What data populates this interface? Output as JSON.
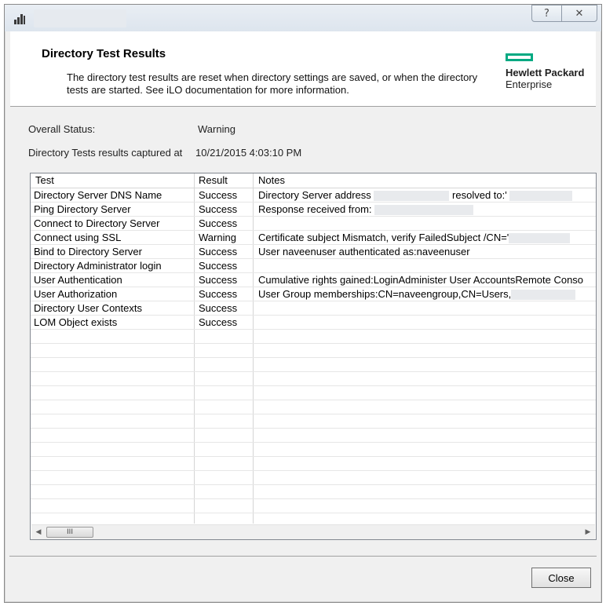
{
  "window": {
    "icons": {
      "app": "app-icon",
      "help": "help-icon",
      "close": "close-icon"
    },
    "help_glyph": "?",
    "close_glyph": "✕"
  },
  "header": {
    "title": "Directory Test Results",
    "description": "The directory test results are reset when directory settings are saved, or when the directory tests are started. See iLO documentation for more information.",
    "logo": {
      "line1": "Hewlett Packard",
      "line2": "Enterprise",
      "color": "#01a982"
    }
  },
  "status": {
    "overall_label": "Overall Status:",
    "overall_value": "Warning",
    "captured_label": "Directory Tests results captured at",
    "captured_value": "10/21/2015 4:03:10 PM"
  },
  "table": {
    "columns": [
      "Test",
      "Result",
      "Notes"
    ],
    "rows": [
      {
        "test": "Directory Server DNS Name",
        "result": "Success",
        "notes": "Directory Server address",
        "notes_suffix": "resolved to:'"
      },
      {
        "test": "Ping Directory Server",
        "result": "Success",
        "notes": "Response received from:"
      },
      {
        "test": "Connect to Directory Server",
        "result": "Success",
        "notes": ""
      },
      {
        "test": "Connect using SSL",
        "result": "Warning",
        "notes": "Certificate subject Mismatch, verify FailedSubject /CN='"
      },
      {
        "test": "Bind to Directory Server",
        "result": "Success",
        "notes": "User naveenuser authenticated as:naveenuser"
      },
      {
        "test": "Directory Administrator login",
        "result": "Success",
        "notes": ""
      },
      {
        "test": "User Authentication",
        "result": "Success",
        "notes": "Cumulative rights gained:LoginAdminister User AccountsRemote Conso"
      },
      {
        "test": "User Authorization",
        "result": "Success",
        "notes": "User Group memberships:CN=naveengroup,CN=Users,"
      },
      {
        "test": "Directory User Contexts",
        "result": "Success",
        "notes": ""
      },
      {
        "test": "LOM Object exists",
        "result": "Success",
        "notes": ""
      }
    ],
    "scroll_thumb_glyph": "III"
  },
  "footer": {
    "close_label": "Close"
  }
}
